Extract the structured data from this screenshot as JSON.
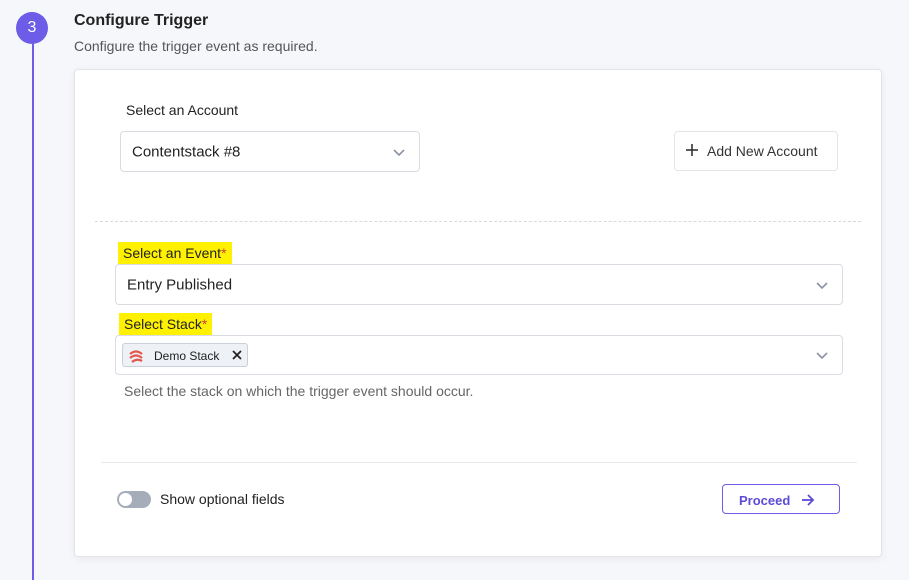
{
  "step": {
    "number": "3",
    "title": "Configure Trigger",
    "subtitle": "Configure the trigger event as required."
  },
  "account": {
    "label": "Select an Account",
    "selected": "Contentstack #8",
    "add_button": "Add New Account"
  },
  "event": {
    "label": "Select an Event",
    "required_mark": "*",
    "selected": "Entry Published"
  },
  "stack": {
    "label": "Select Stack",
    "required_mark": "*",
    "chip_label": "Demo Stack",
    "help_text": "Select the stack on which the trigger event should occur."
  },
  "footer": {
    "toggle_label": "Show optional fields",
    "toggle_on": false,
    "proceed_label": "Proceed"
  },
  "colors": {
    "accent": "#6c5ce7",
    "highlight": "#fff100",
    "required": "#d63c3c"
  },
  "icons": [
    "chevron-down-icon",
    "plus-icon",
    "contentstack-logo-icon",
    "close-icon",
    "arrow-right-icon"
  ]
}
